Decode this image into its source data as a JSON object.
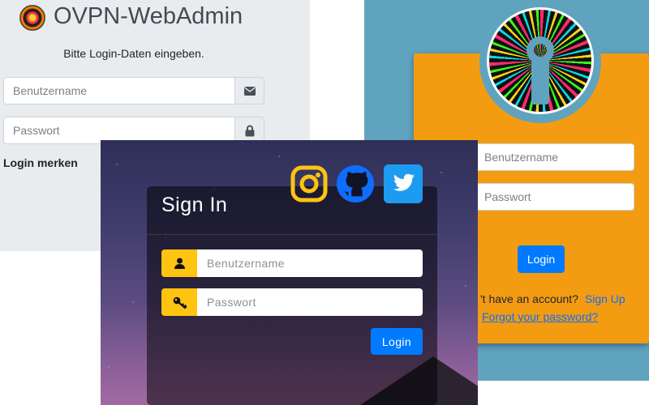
{
  "admin_login": {
    "title": "OVPN-WebAdmin",
    "hint": "Bitte Login-Daten eingeben.",
    "username_placeholder": "Benutzername",
    "password_placeholder": "Passwort",
    "remember_label": "Login merken",
    "icons": {
      "logo": "openvpn-logo-icon",
      "username": "envelope-icon",
      "password": "lock-icon"
    }
  },
  "orange_login": {
    "username_placeholder": "Benutzername",
    "password_placeholder": "Passwort",
    "login_label": "Login",
    "signup_text": "'t have an account?",
    "signup_link": "Sign Up",
    "forgot_link": "Forgot your password?",
    "colors": {
      "background": "#60a3bf",
      "card": "#f39c12",
      "button": "#007bff"
    }
  },
  "night_login": {
    "title": "Sign In",
    "username_placeholder": "Benutzername",
    "password_placeholder": "Passwort",
    "login_label": "Login",
    "social_icons": [
      "instagram-icon",
      "github-icon",
      "twitter-icon"
    ],
    "colors": {
      "addon": "#ffc312",
      "button": "#007bff"
    }
  }
}
